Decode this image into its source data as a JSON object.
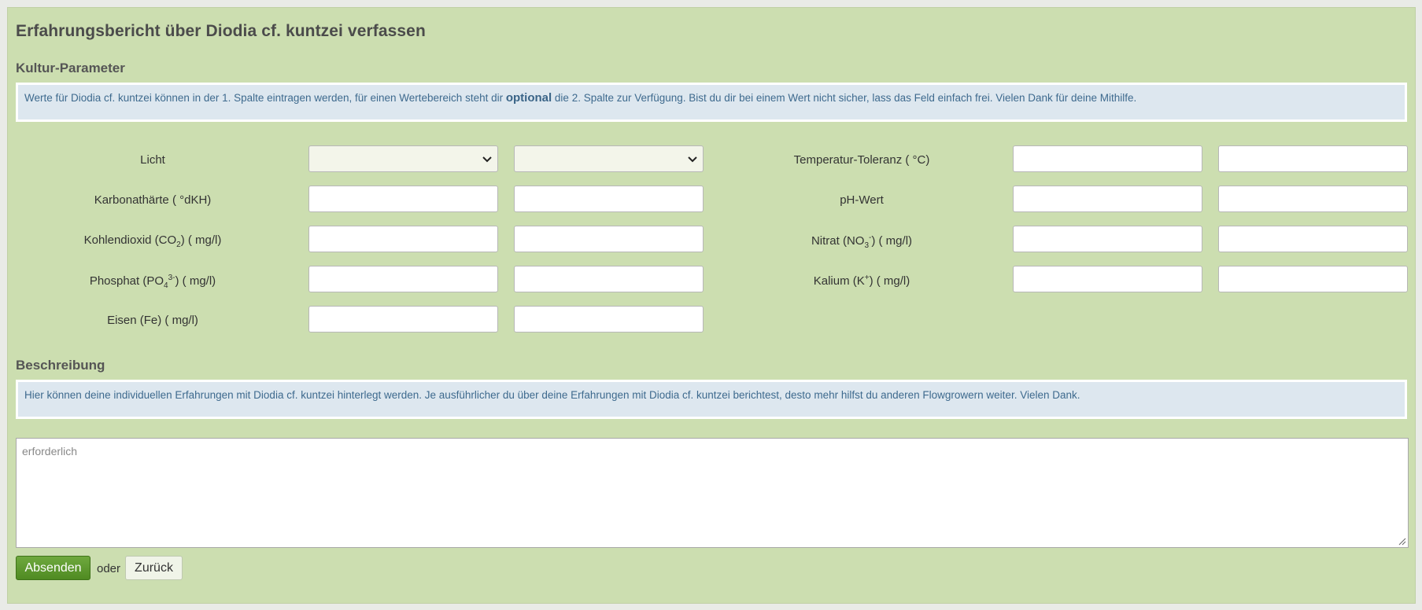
{
  "page": {
    "title": "Erfahrungsbericht über Diodia cf. kuntzei verfassen"
  },
  "parameters": {
    "heading": "Kultur-Parameter",
    "info_part1": "Werte für Diodia cf. kuntzei können in der 1. Spalte eintragen werden, für einen Wertebereich steht dir ",
    "info_bold": "optional",
    "info_part2": " die 2. Spalte zur Verfügung. Bist du dir bei einem Wert nicht sicher, lass das Feld einfach frei. Vielen Dank für deine Mithilfe.",
    "left": [
      {
        "label": "Licht",
        "type": "select",
        "value1": "",
        "value2": ""
      },
      {
        "label": "Karbonathärte ( °dKH)",
        "type": "text",
        "value1": "",
        "value2": ""
      },
      {
        "label_pre": "Kohlendioxid (CO",
        "sub": "2",
        "sup": "",
        "label_post": ") ( mg/l)",
        "type": "text",
        "value1": "",
        "value2": ""
      },
      {
        "label_pre": "Phosphat (PO",
        "sub": "4",
        "sup": "3-",
        "label_post": ") ( mg/l)",
        "type": "text",
        "value1": "",
        "value2": ""
      },
      {
        "label": "Eisen (Fe) ( mg/l)",
        "type": "text",
        "value1": "",
        "value2": ""
      }
    ],
    "right": [
      {
        "label": "Temperatur-Toleranz ( °C)",
        "type": "text",
        "value1": "",
        "value2": ""
      },
      {
        "label": "pH-Wert",
        "type": "text",
        "value1": "",
        "value2": ""
      },
      {
        "label_pre": "Nitrat (NO",
        "sub": "3",
        "sup": "-",
        "label_post": ") ( mg/l)",
        "type": "text",
        "value1": "",
        "value2": ""
      },
      {
        "label_pre": "Kalium (K",
        "sub": "",
        "sup": "+",
        "label_post": ") ( mg/l)",
        "type": "text",
        "value1": "",
        "value2": ""
      }
    ]
  },
  "description": {
    "heading": "Beschreibung",
    "info": "Hier können deine individuellen Erfahrungen mit Diodia cf. kuntzei hinterlegt werden. Je ausführlicher du über deine Erfahrungen mit Diodia cf. kuntzei berichtest, desto mehr hilfst du anderen Flowgrowern weiter. Vielen Dank.",
    "placeholder": "erforderlich",
    "value": ""
  },
  "actions": {
    "submit_label": "Absenden",
    "or_text": "oder",
    "back_label": "Zurück"
  },
  "icons": {
    "select_chevron": "chevron-down-icon",
    "resize_handle": "resize-handle-icon"
  },
  "colors": {
    "panel_bg": "#ccdeb0",
    "info_bg": "#dde7ef",
    "info_text": "#3e6a8e",
    "submit_bg": "#5a9a2c"
  }
}
